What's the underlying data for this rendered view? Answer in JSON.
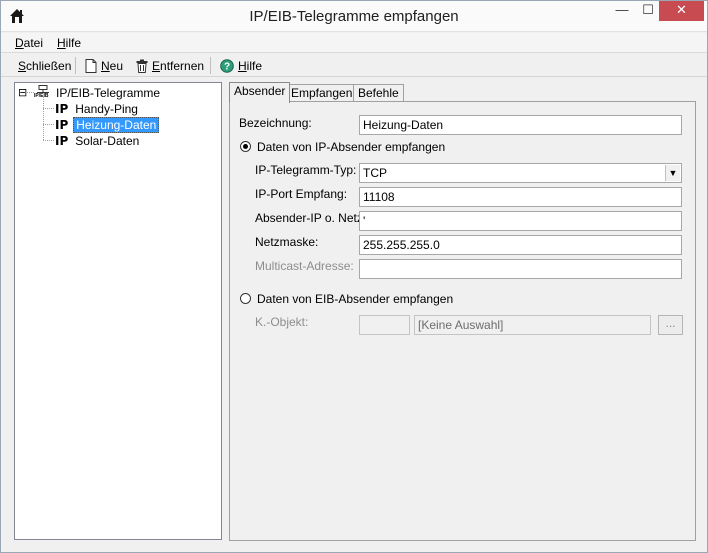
{
  "window": {
    "title": "IP/EIB-Telegramme empfangen",
    "close_glyph": "✕",
    "minimize_glyph": "—",
    "maximize_glyph": "☐"
  },
  "menu": [
    {
      "mnemonic": "D",
      "rest": "atei"
    },
    {
      "mnemonic": "H",
      "rest": "ilfe"
    }
  ],
  "toolbar": {
    "close": {
      "mnemonic": "S",
      "rest": "chließen"
    },
    "new": {
      "mnemonic": "N",
      "rest": "eu"
    },
    "remove": {
      "mnemonic": "E",
      "rest": "ntfernen"
    },
    "help": {
      "mnemonic": "H",
      "rest": "ilfe"
    }
  },
  "tree": {
    "expander": "⊟",
    "root_label": "IP/EIB-Telegramme",
    "root_icon_text": "IP/EIB",
    "child_prefix": "IP",
    "children": [
      "Handy-Ping",
      "Heizung-Daten",
      "Solar-Daten"
    ],
    "selected_index": 1
  },
  "tabs": [
    "Absender",
    "Empfangen",
    "Befehle"
  ],
  "active_tab": 0,
  "form": {
    "bezeichnung_label": "Bezeichnung:",
    "bezeichnung_value": "Heizung-Daten",
    "ip_radio_label": "Daten von IP-Absender empfangen",
    "ip_radio_checked": true,
    "typ_label": "IP-Telegramm-Typ:",
    "typ_value": "TCP",
    "port_label": "IP-Port Empfang:",
    "port_value": "11108",
    "absender_label": "Absender-IP o. Netz:",
    "absender_value": "'",
    "netzmaske_label": "Netzmaske:",
    "netzmaske_value": "255.255.255.0",
    "multicast_label": "Multicast-Adresse:",
    "multicast_value": "",
    "eib_radio_label": "Daten von EIB-Absender empfangen",
    "eib_radio_checked": false,
    "kobjekt_label": "K.-Objekt:",
    "kobjekt_value": "",
    "kobjekt_selection": "[Keine Auswahl]",
    "browse_label": "..."
  }
}
